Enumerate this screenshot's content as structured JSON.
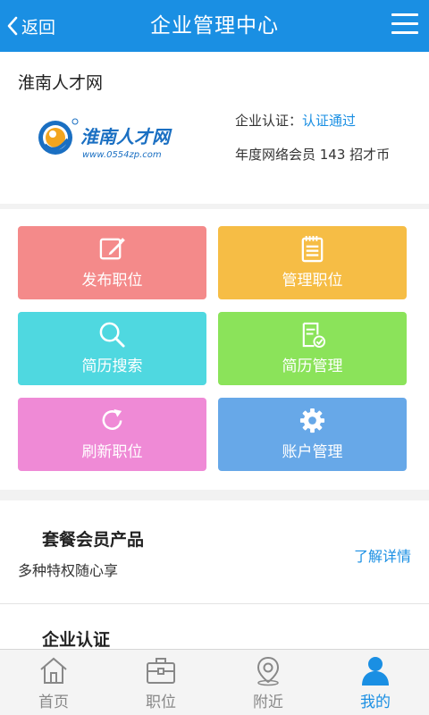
{
  "header": {
    "back_label": "返回",
    "title": "企业管理中心"
  },
  "company": {
    "name": "淮南人才网",
    "logo_text": "淮南人才网",
    "logo_url": "www.0554zp.com",
    "cert_label": "企业认证：",
    "cert_status": "认证通过",
    "member_text": "年度网络会员 143 招才币"
  },
  "tiles": [
    {
      "label": "发布职位",
      "icon": "edit-icon",
      "color": "#f48a8a"
    },
    {
      "label": "管理职位",
      "icon": "notepad-icon",
      "color": "#f6bd45"
    },
    {
      "label": "简历搜索",
      "icon": "search-icon",
      "color": "#4fd8e0"
    },
    {
      "label": "简历管理",
      "icon": "resume-check-icon",
      "color": "#8be35a"
    },
    {
      "label": "刷新职位",
      "icon": "refresh-icon",
      "color": "#ef8ad6"
    },
    {
      "label": "账户管理",
      "icon": "gear-icon",
      "color": "#67a8e8"
    }
  ],
  "package": {
    "title": "套餐会员产品",
    "subtitle": "多种特权随心享",
    "link": "了解详情",
    "auth_title": "企业认证"
  },
  "tabbar": {
    "items": [
      {
        "label": "首页",
        "icon": "home-icon"
      },
      {
        "label": "职位",
        "icon": "briefcase-icon"
      },
      {
        "label": "附近",
        "icon": "location-pin-icon"
      },
      {
        "label": "我的",
        "icon": "user-icon",
        "active": true
      }
    ]
  }
}
